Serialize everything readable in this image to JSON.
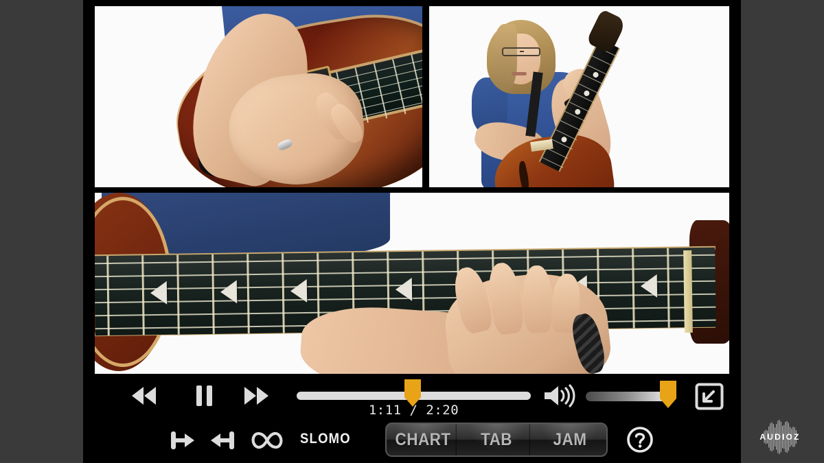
{
  "app": {
    "title": "Guitar Lesson Video Player",
    "background_color": "#3a3a3a",
    "frame_color": "#000000",
    "accent_color": "#e8a317"
  },
  "video": {
    "panels": [
      {
        "name": "picking-hand-closeup",
        "position": "top-left",
        "description": "Close-up of a right hand picking the strings of a sunburst hollow-body archtop guitar, player wearing a blue shirt, wedding ring on ring finger, white studio background"
      },
      {
        "name": "instructor-full-shot",
        "position": "top-right",
        "description": "Instructor with curly blonde shoulder-length hair and eyeglasses, wearing a blue polo shirt and black guitar strap, playing a semi-hollow electric guitar against a white background"
      },
      {
        "name": "fretboard-closeup",
        "position": "bottom",
        "description": "Wide close-up of the guitar neck and ebony fretboard with split-parallelogram pearl inlays, left hand fretting in the upper register, white studio background"
      }
    ]
  },
  "controls": {
    "transport": {
      "rewind": {
        "label": "Rewind",
        "icon": "rewind-icon"
      },
      "playpause": {
        "label": "Pause",
        "icon": "pause-icon",
        "state": "playing"
      },
      "forward": {
        "label": "Fast Forward",
        "icon": "fast-forward-icon"
      }
    },
    "progress": {
      "current_time": "1:11",
      "total_time": "2:20",
      "time_display": "1:11 / 2:20",
      "percent": 50,
      "handle_color": "#e8a317"
    },
    "volume": {
      "icon": "volume-high-icon",
      "percent": 91,
      "handle_color": "#e8a317"
    },
    "fullscreen": {
      "label": "Exit Fullscreen",
      "icon": "exit-fullscreen-icon"
    },
    "loop": {
      "set_in": {
        "label": "Set Loop In",
        "icon": "loop-in-icon"
      },
      "set_out": {
        "label": "Set Loop Out",
        "icon": "loop-out-icon"
      },
      "toggle": {
        "label": "Loop",
        "icon": "infinity-icon"
      }
    },
    "slomo": {
      "label": "SLOMO"
    },
    "view_tabs": {
      "options": [
        {
          "label": "CHART",
          "name": "chart"
        },
        {
          "label": "TAB",
          "name": "tab"
        },
        {
          "label": "JAM",
          "name": "jam"
        }
      ],
      "selected": "CHART"
    },
    "help": {
      "label": "Help",
      "icon": "help-icon"
    }
  },
  "watermark": {
    "text": "AUDIOZ"
  }
}
